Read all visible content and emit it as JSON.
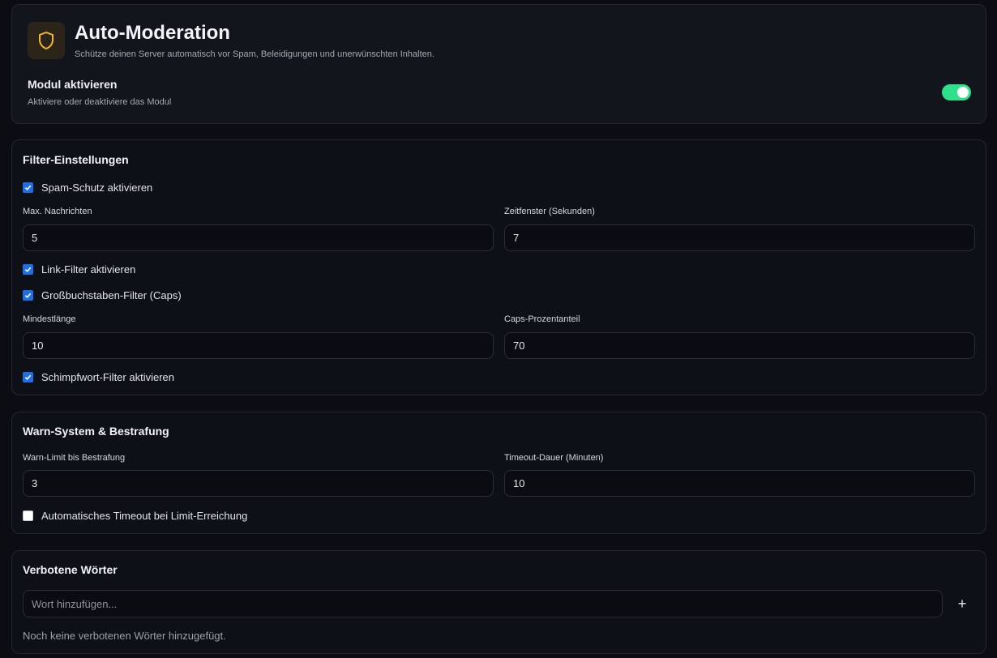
{
  "header": {
    "title": "Auto-Moderation",
    "subtitle": "Schütze deinen Server automatisch vor Spam, Beleidigungen und unerwünschten Inhalten.",
    "icon": "shield-icon",
    "accent": "#f5b731"
  },
  "module": {
    "title": "Modul aktivieren",
    "subtitle": "Aktiviere oder deaktiviere das Modul",
    "enabled": true,
    "toggle_color": "#2ee08a"
  },
  "filter": {
    "title": "Filter-Einstellungen",
    "spam": {
      "label": "Spam-Schutz aktivieren",
      "checked": true
    },
    "max_messages": {
      "label": "Max. Nachrichten",
      "value": "5"
    },
    "time_window": {
      "label": "Zeitfenster (Sekunden)",
      "value": "7"
    },
    "link": {
      "label": "Link-Filter aktivieren",
      "checked": true
    },
    "caps": {
      "label": "Großbuchstaben-Filter (Caps)",
      "checked": true
    },
    "min_length": {
      "label": "Mindestlänge",
      "value": "10"
    },
    "caps_percent": {
      "label": "Caps-Prozentanteil",
      "value": "70"
    },
    "profanity": {
      "label": "Schimpfwort-Filter aktivieren",
      "checked": true
    }
  },
  "warn": {
    "title": "Warn-System & Bestrafung",
    "warn_limit": {
      "label": "Warn-Limit bis Bestrafung",
      "value": "3"
    },
    "timeout_duration": {
      "label": "Timeout-Dauer (Minuten)",
      "value": "10"
    },
    "auto_timeout": {
      "label": "Automatisches Timeout bei Limit-Erreichung",
      "checked": false
    }
  },
  "words": {
    "title": "Verbotene Wörter",
    "input_placeholder": "Wort hinzufügen...",
    "add_label": "+",
    "empty_text": "Noch keine verbotenen Wörter hinzugefügt."
  },
  "colors": {
    "checkbox_on": "#1e6fe6",
    "background": "#0b0d12"
  }
}
